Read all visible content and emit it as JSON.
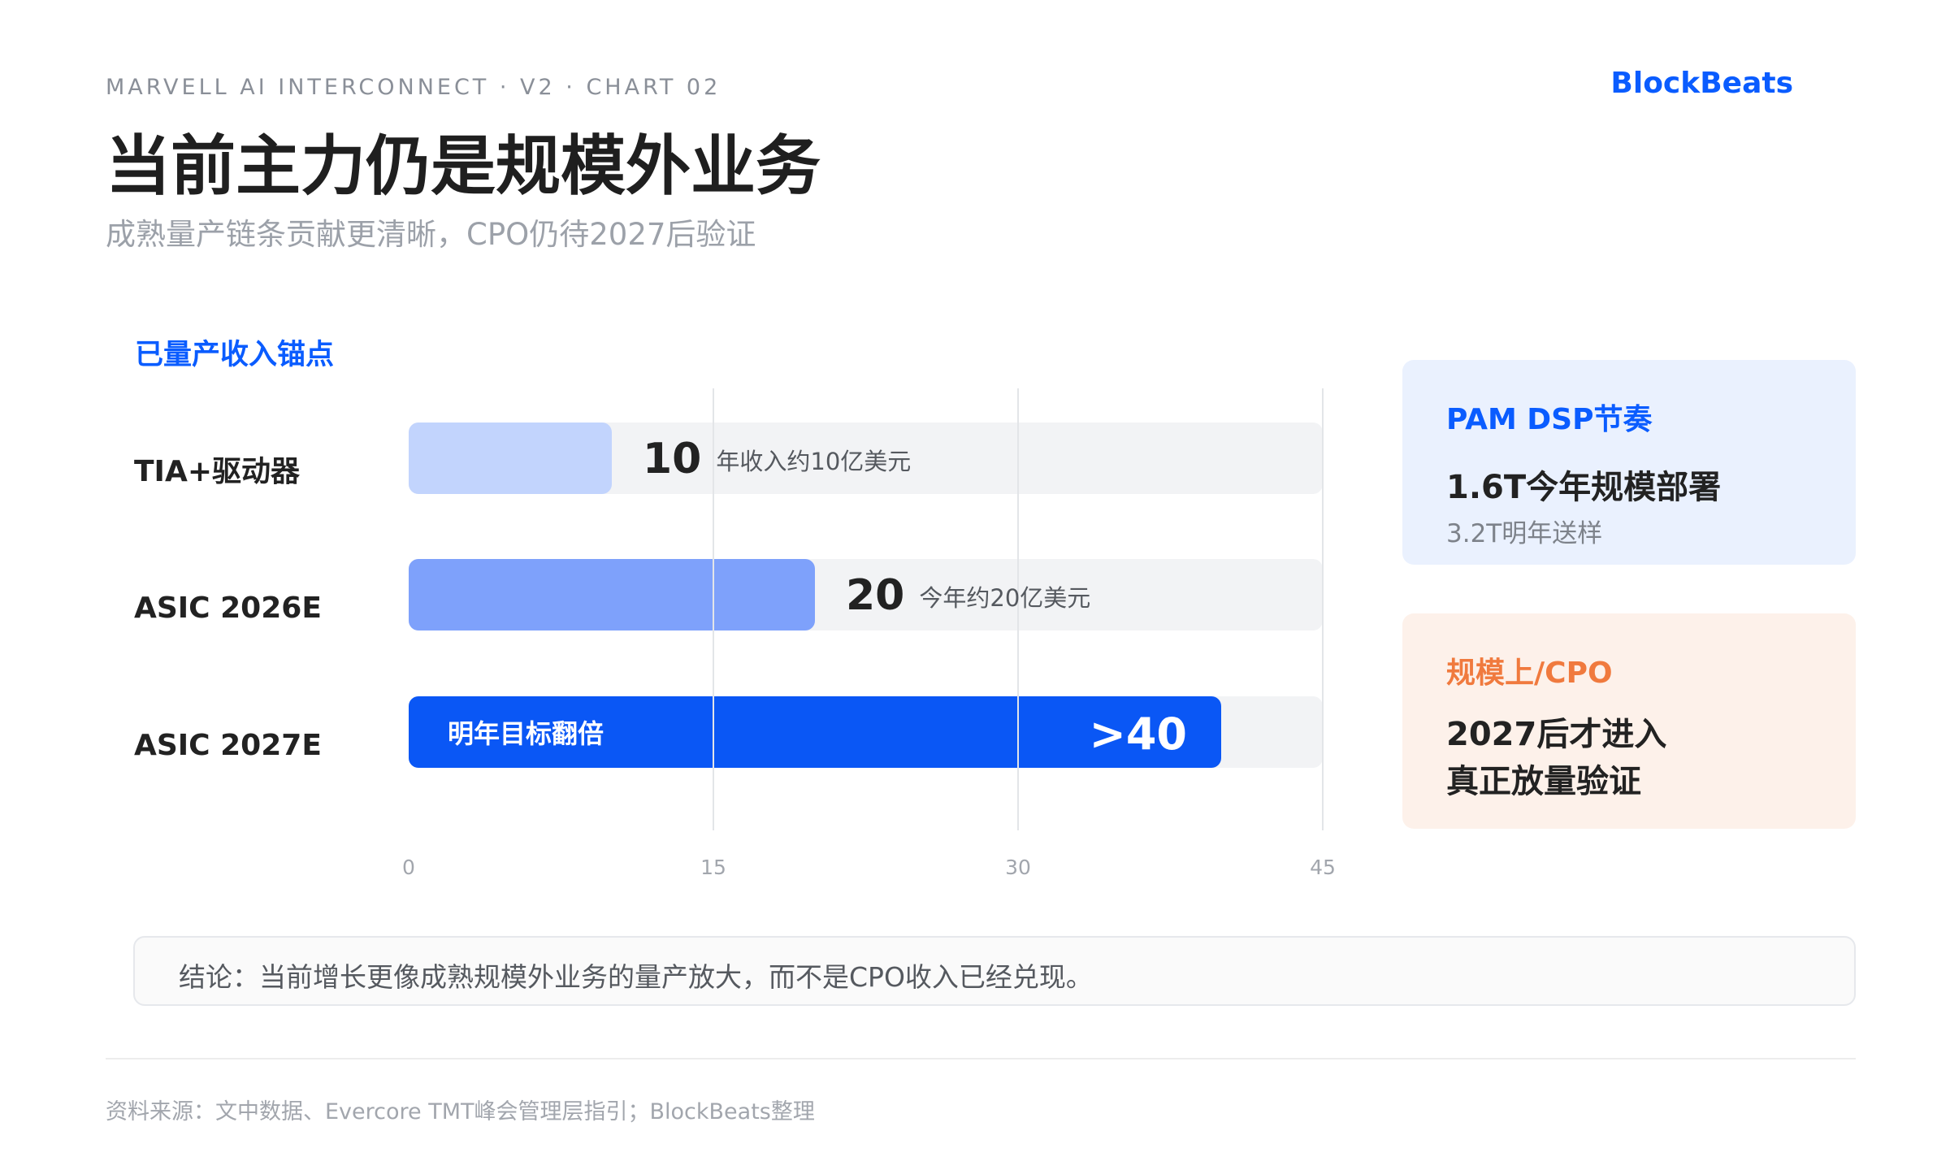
{
  "header": {
    "eyebrow": "MARVELL AI INTERCONNECT · V2 · CHART 02",
    "brand": "BlockBeats",
    "title": "当前主力仍是规模外业务",
    "subtitle": "成熟量产链条贡献更清晰，CPO仍待2027后验证"
  },
  "section_label": "已量产收入锚点",
  "chart_data": {
    "type": "bar",
    "orientation": "horizontal",
    "categories": [
      "TIA+驱动器",
      "ASIC 2026E",
      "ASIC 2027E"
    ],
    "values": [
      10,
      20,
      40
    ],
    "value_labels": [
      "10",
      "20",
      ">40"
    ],
    "notes": [
      "年收入约10亿美元",
      "今年约20亿美元",
      "明年目标翻倍"
    ],
    "colors": [
      "#c2d4fd",
      "#7ea1fb",
      "#0a57f5"
    ],
    "track_color": "#f2f3f5",
    "xlim": [
      0,
      45
    ],
    "xticks": [
      0,
      15,
      30,
      45
    ],
    "grid": true
  },
  "cards": {
    "pam": {
      "title": "PAM DSP节奏",
      "main": "1.6T今年规模部署",
      "sub": "3.2T明年送样"
    },
    "cpo": {
      "title": "规模上/CPO",
      "line1": "2027后才进入",
      "line2": "真正放量验证"
    }
  },
  "conclusion": "结论：当前增长更像成熟规模外业务的量产放大，而不是CPO收入已经兑现。",
  "source": "资料来源：文中数据、Evercore TMT峰会管理层指引；BlockBeats整理",
  "colors": {
    "accent": "#0a5cff",
    "orange": "#f07a3e"
  }
}
